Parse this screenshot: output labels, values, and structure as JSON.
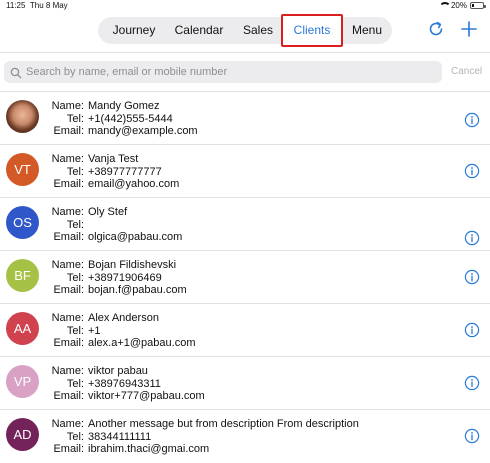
{
  "status_bar": {
    "time": "11:25",
    "date": "Thu 8 May",
    "battery": "20%",
    "battery_level": 0.2
  },
  "tabs": [
    {
      "label": "Journey"
    },
    {
      "label": "Calendar"
    },
    {
      "label": "Sales"
    },
    {
      "label": "Clients",
      "selected": true
    },
    {
      "label": "Menu"
    }
  ],
  "toolbar": {
    "refresh_icon": "refresh-icon",
    "add_icon": "plus-icon"
  },
  "search": {
    "value": "",
    "placeholder": "Search by name, email or mobile number",
    "cancel": "Cancel"
  },
  "labels": {
    "name": "Name:",
    "tel": "Tel:",
    "email": "Email:"
  },
  "clients": [
    {
      "initials": "",
      "photo": true,
      "color": "",
      "name": "Mandy Gomez",
      "tel": "+1(442)555-5444",
      "email": "mandy@example.com"
    },
    {
      "initials": "VT",
      "color": "#d35a26",
      "name": "Vanja Test",
      "tel": "+38977777777",
      "email": "email@yahoo.com"
    },
    {
      "initials": "OS",
      "color": "#2f57c9",
      "name": "Oly Stef",
      "tel": "",
      "email": "olgica@pabau.com"
    },
    {
      "initials": "BF",
      "color": "#a6c246",
      "name": "Bojan Fildishevski",
      "tel": "+38971906469",
      "email": "bojan.f@pabau.com"
    },
    {
      "initials": "AA",
      "color": "#cf424e",
      "name": "Alex Anderson",
      "tel": "+1",
      "email": "alex.a+1@pabau.com"
    },
    {
      "initials": "VP",
      "color": "#d9a2c4",
      "name": "viktor pabau",
      "tel": "+38976943311",
      "email": "viktor+777@pabau.com"
    },
    {
      "initials": "AD",
      "color": "#74225a",
      "name": "Another message but from description From description",
      "tel": "38344111111",
      "email": "ibrahim.thaci@gmai.com"
    }
  ],
  "colors": {
    "accent": "#2a7ad6",
    "highlight_border": "#d9201e"
  }
}
